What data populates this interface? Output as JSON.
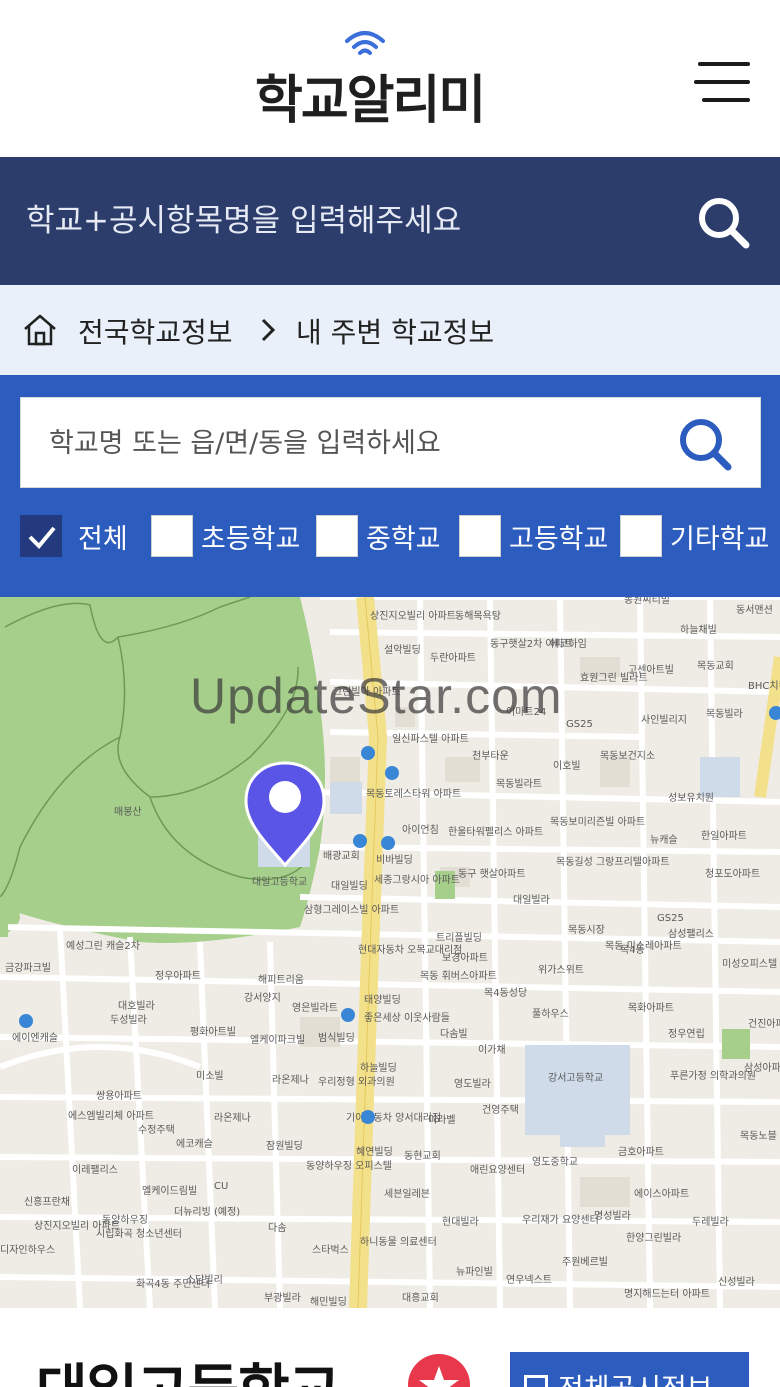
{
  "header": {
    "logo_text": "학교알리미",
    "menu_icon": "hamburger-menu-icon"
  },
  "top_search": {
    "placeholder": "학교+공시항목명을 입력해주세요",
    "icon": "search-icon"
  },
  "breadcrumb": {
    "home_icon": "home-icon",
    "items": [
      "전국학교정보",
      "내 주변 학교정보"
    ]
  },
  "filter": {
    "search_placeholder": "학교명 또는 읍/면/동을 입력하세요",
    "options": [
      {
        "label": "전체",
        "checked": true
      },
      {
        "label": "초등학교",
        "checked": false
      },
      {
        "label": "중학교",
        "checked": false
      },
      {
        "label": "고등학교",
        "checked": false
      },
      {
        "label": "기타학교",
        "checked": false
      }
    ]
  },
  "map": {
    "watermark": "UpdateStar.com",
    "marker_label": "대일고등학교",
    "labels": {
      "l1": "상진지오빌리 아파트",
      "l2": "동해목욕탕",
      "l3": "설악빌딩",
      "l4": "두란아파트",
      "l5": "동구햇살2차 아파트",
      "l6": "에코하임",
      "l7": "하늘채빌",
      "l8": "목동교회",
      "l9": "고센아트빌",
      "l10": "효원그린 빌라트",
      "l11": "그린빌아 아파트",
      "l12": "이마트24",
      "l13": "GS25",
      "l14": "사인빌리지",
      "l15": "목동빌라",
      "l16": "일신파스텔 아파트",
      "l17": "천부타운",
      "l18": "목동보건지소",
      "l19": "이호빌",
      "l20": "목동빌라트",
      "l21": "성보유치원",
      "l22": "목동토레스타워 아파트",
      "l23": "아이언침",
      "l24": "한울타워펠리스 아파트",
      "l25": "목동보미리즌빌 아파트",
      "l26": "뉴캐슬",
      "l27": "한일아파트",
      "l28": "매봉산",
      "l29": "배광교회",
      "l30": "비바빌딩",
      "l31": "세종그랑시아 아파트",
      "l32": "동구 햇살아파트",
      "l33": "목동길성 그랑프리텔아파트",
      "l34": "청포도아파트",
      "l35": "대일빌딩",
      "l36": "대일빌라",
      "l37": "삼형그레이스빌 아파트",
      "l38": "GS25",
      "l39": "삼성팰리스",
      "l40": "예성그린 캐슬2차",
      "l41": "현대자동차 오목교대리점",
      "l42": "트리플빌딩",
      "l43": "목동시장",
      "l44": "금강파크빌",
      "l45": "정우아파트",
      "l46": "보경아파트",
      "l47": "위가스위트",
      "l48": "목동 미소레아파트",
      "l49": "미성오피스텔",
      "l50": "해피트리움",
      "l51": "목동 휘버스아파트",
      "l52": "목4동성당",
      "l53": "대호빌라",
      "l54": "강서양지",
      "l55": "영은빌라트",
      "l56": "태양빌딩",
      "l57": "좋은세상 이웃사람들",
      "l58": "풀하우스",
      "l59": "목화아파트",
      "l60": "두성빌라",
      "l61": "평화아트빌",
      "l62": "범식빌딩",
      "l63": "다솜빌",
      "l64": "정우연립",
      "l65": "엘케이파크빌",
      "l66": "에이엔캐슬",
      "l67": "미소빌",
      "l68": "하늘빌딩",
      "l69": "이가채",
      "l70": "강서고등학교",
      "l71": "라온제나",
      "l72": "우리정형 외과의원",
      "l73": "영도빌라",
      "l74": "쌍용아파트",
      "l75": "푸른가정 의학과의원",
      "l76": "에스엠빌리체 아파트",
      "l77": "수정주택",
      "l78": "라온제나",
      "l79": "기아자동차 양서대리점",
      "l80": "미라벨",
      "l81": "건영주택",
      "l82": "에코캐슬",
      "l83": "잠원빌딩",
      "l84": "혜연빌딩",
      "l85": "동현교회",
      "l86": "목동노블 아파트",
      "l87": "이레팰리스",
      "l88": "동양하우징 오피스텔",
      "l89": "애린요양센터",
      "l90": "영도중학교",
      "l91": "금호아파트",
      "l92": "신흥프란채",
      "l93": "엘케이드림빌",
      "l94": "CU",
      "l95": "세븐일레븐",
      "l96": "에이스아파트",
      "l97": "동양하우징",
      "l98": "더뉴리빙 (예정)",
      "l99": "현대빌라",
      "l100": "명성빌라",
      "l101": "두레빌라",
      "l102": "상진지오빌리 아파트",
      "l103": "시립화곡 청소년센터",
      "l104": "다솜",
      "l105": "스타벅스",
      "l106": "하니동물 의료센터",
      "l107": "우리재가 요양센터",
      "l108": "한양그린빌라",
      "l109": "디자인하우스",
      "l110": "화곡4동 주민센터",
      "l111": "소담빌리",
      "l112": "주원베르빌",
      "l113": "뉴파인빌",
      "l114": "연우넥스트",
      "l115": "부광빌라",
      "l116": "해민빌딩",
      "l117": "대흥교회",
      "l118": "명지해드는터 아파트",
      "l119": "신성빌라",
      "l120": "동서맨션",
      "l121": "동원씨티빌",
      "l122": "BHC치킨",
      "l123": "건진아파트",
      "l124": "삼성아파트",
      "l125": "목4동"
    }
  },
  "school_card": {
    "name": "대일고등학교",
    "favorite_icon": "star-icon",
    "all_info_label": "전체공시정보"
  },
  "colors": {
    "navy": "#2c3d6b",
    "blue": "#2c5cbd",
    "checked": "#233a7e",
    "breadcrumb_bg": "#e9f0f9",
    "marker": "#5a55e6",
    "favorite": "#e8384b"
  }
}
